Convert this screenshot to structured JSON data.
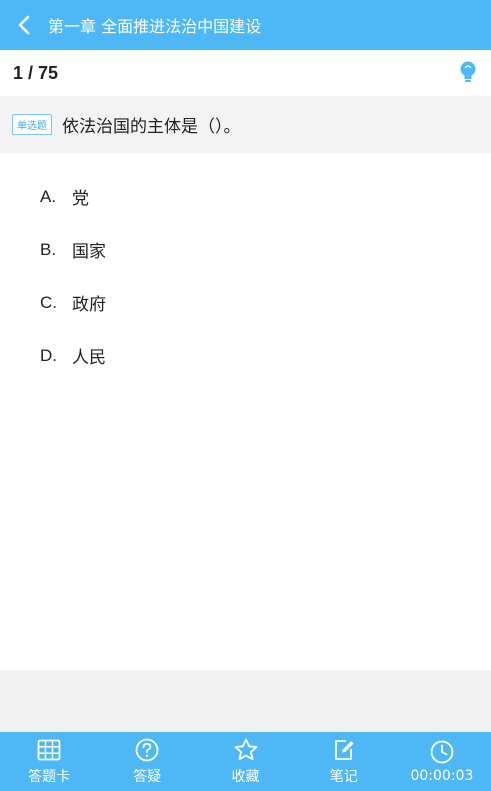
{
  "header": {
    "title": "第一章 全面推进法治中国建设",
    "back_icon": "chevron-left-icon",
    "background": "#4db8f5"
  },
  "progress": {
    "current": 1,
    "total": 75,
    "text": "1 / 75",
    "hint_icon": "lightbulb-icon"
  },
  "question": {
    "type_badge": "单选题",
    "text": "依法治国的主体是（）。"
  },
  "options": [
    {
      "letter": "A.",
      "text": "党"
    },
    {
      "letter": "B.",
      "text": "国家"
    },
    {
      "letter": "C.",
      "text": "政府"
    },
    {
      "letter": "D.",
      "text": "人民"
    }
  ],
  "tabbar": {
    "background": "#4db8f5",
    "tabs": [
      {
        "label": "答题卡",
        "icon": "grid-icon"
      },
      {
        "label": "答疑",
        "icon": "question-circle-icon"
      },
      {
        "label": "收藏",
        "icon": "star-icon"
      },
      {
        "label": "笔记",
        "icon": "edit-icon"
      },
      {
        "label": "00:00:03",
        "icon": "clock-icon"
      }
    ]
  }
}
